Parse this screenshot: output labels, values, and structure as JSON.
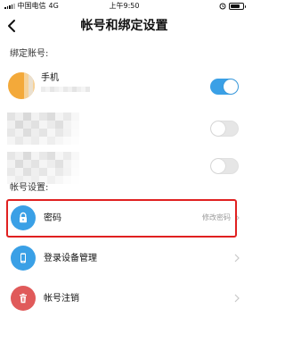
{
  "status_bar": {
    "carrier": "中国电信",
    "network": "4G",
    "time": "上午9:50"
  },
  "nav": {
    "title": "帐号和绑定设置"
  },
  "bound_accounts": {
    "header": "绑定账号:",
    "items": [
      {
        "label": "手机",
        "enabled": true
      },
      {
        "label": "",
        "enabled": false
      },
      {
        "label": "",
        "enabled": false
      }
    ]
  },
  "account_settings": {
    "header": "帐号设置:",
    "items": [
      {
        "label": "密码",
        "value": "修改密码",
        "icon": "lock-icon",
        "icon_color": "#3aa0e6"
      },
      {
        "label": "登录设备管理",
        "value": "",
        "icon": "phone-icon",
        "icon_color": "#3aa0e6"
      },
      {
        "label": "帐号注销",
        "value": "",
        "icon": "trash-icon",
        "icon_color": "#e05a5a"
      }
    ]
  },
  "colors": {
    "accent": "#3aa0e6",
    "avatar": "#f3a93a",
    "danger": "#e05a5a",
    "highlight": "#e02020"
  }
}
